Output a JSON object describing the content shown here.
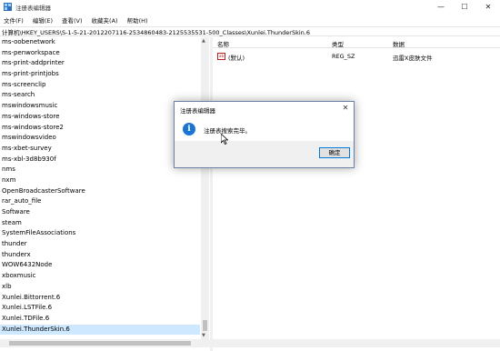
{
  "window": {
    "title": "注册表编辑器",
    "controls": {
      "minimize": "—",
      "maximize": "☐",
      "close": "✕"
    }
  },
  "menu": [
    "文件(F)",
    "编辑(E)",
    "查看(V)",
    "收藏夹(A)",
    "帮助(H)"
  ],
  "address": "计算机\\HKEY_USERS\\S-1-5-21-2012207116-2534860483-2125535531-500_Classes\\Xunlei.ThunderSkin.6",
  "tree": {
    "items": [
      "ms-oobenetwork",
      "ms-penworkspace",
      "ms-print-addprinter",
      "ms-print-printjobs",
      "ms-screenclip",
      "ms-search",
      "mswindowsmusic",
      "ms-windows-store",
      "ms-windows-store2",
      "mswindowsvideo",
      "ms-xbet-survey",
      "ms-xbl-3d8b930f",
      "nms",
      "nxm",
      "OpenBroadcasterSoftware",
      "rar_auto_file",
      "Software",
      "steam",
      "SystemFileAssociations",
      "thunder",
      "thunderx",
      "WOW6432Node",
      "xboxmusic",
      "xlb",
      "Xunlei.Bittorrent.6",
      "Xunlei.LSTFile.6",
      "Xunlei.TDFile.6",
      "Xunlei.ThunderSkin.6"
    ],
    "selected_index": 27
  },
  "list": {
    "headers": {
      "name": "名称",
      "type": "类型",
      "data": "数据"
    },
    "rows": [
      {
        "icon": "ab",
        "name": "(默认)",
        "type": "REG_SZ",
        "data": "迅雷X皮肤文件"
      }
    ]
  },
  "dialog": {
    "title": "注册表编辑器",
    "close": "✕",
    "icon": "i",
    "message": "注册表搜索完毕。",
    "ok": "确定"
  },
  "colors": {
    "selection": "#cde8ff",
    "info_icon": "#1a75d2",
    "button_border": "#0078d7"
  }
}
